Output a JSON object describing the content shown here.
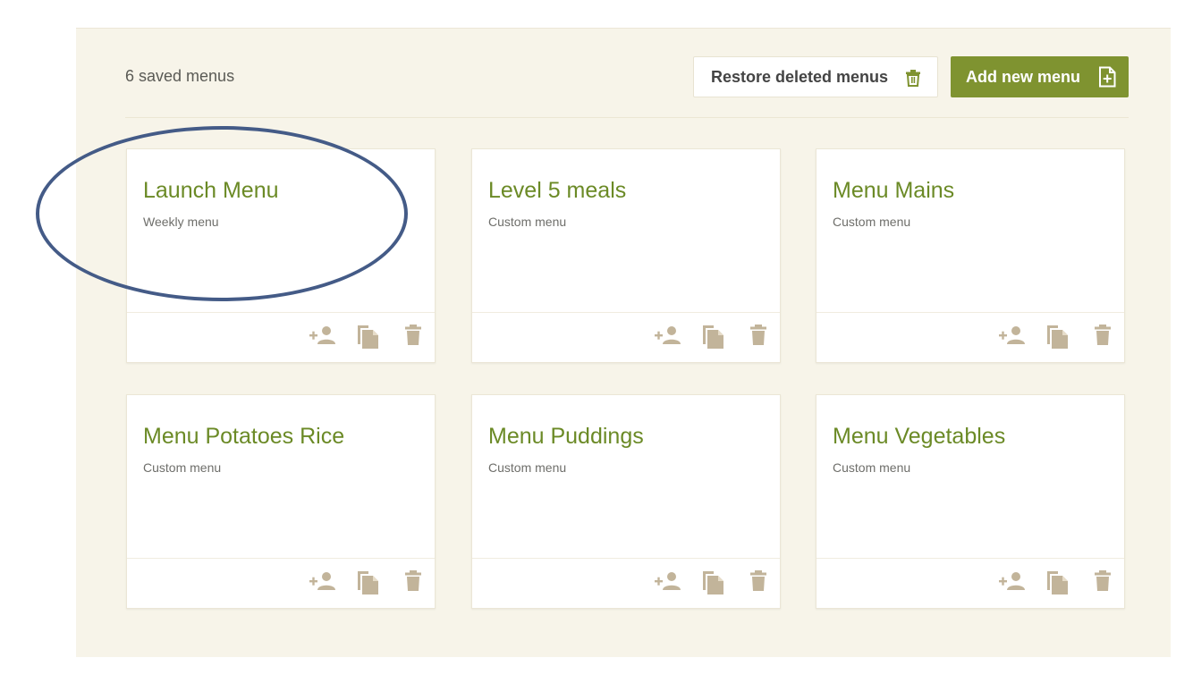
{
  "header": {
    "count_text": "6 saved menus",
    "restore_label": "Restore deleted menus",
    "restore_icon": "trash-can-icon",
    "add_label": "Add new menu",
    "add_icon": "file-plus-icon"
  },
  "menus": [
    {
      "title": "Launch Menu",
      "subtitle": "Weekly menu"
    },
    {
      "title": "Level 5 meals",
      "subtitle": "Custom menu"
    },
    {
      "title": "Menu Mains",
      "subtitle": "Custom menu"
    },
    {
      "title": "Menu Potatoes Rice",
      "subtitle": "Custom menu"
    },
    {
      "title": "Menu Puddings",
      "subtitle": "Custom menu"
    },
    {
      "title": "Menu Vegetables",
      "subtitle": "Custom menu"
    }
  ],
  "card_actions": [
    "share-user-icon",
    "copy-icon",
    "delete-icon"
  ],
  "colors": {
    "accent": "#7f9330",
    "title": "#6b8a26",
    "icon": "#c2b49a",
    "panel": "#f7f4e9",
    "annotation": "#445b87"
  }
}
